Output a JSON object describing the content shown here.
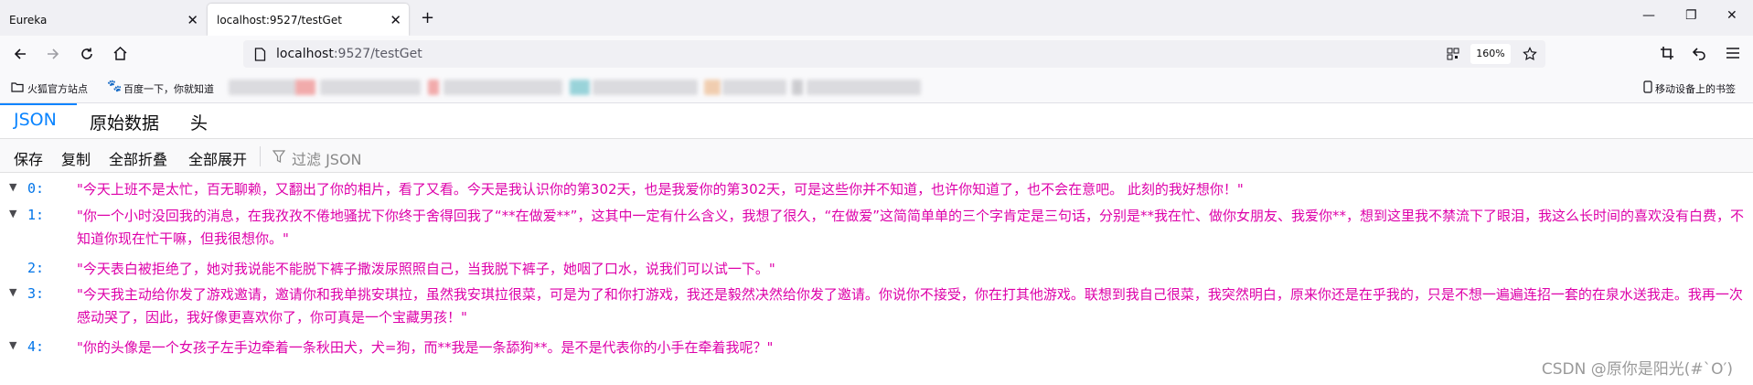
{
  "browser": {
    "tabs": [
      {
        "title": "Eureka"
      },
      {
        "title": "localhost:9527/testGet"
      }
    ],
    "new_tab_symbol": "+",
    "close_symbol": "✕",
    "window_controls": {
      "minimize": "—",
      "restore": "❐",
      "close": "✕"
    },
    "url": {
      "host": "localhost",
      "path": ":9527/testGet"
    },
    "zoom": "160%",
    "bookmarks": [
      {
        "label": "火狐官方站点",
        "icon": "folder-icon"
      },
      {
        "label": "百度一下，你就知道",
        "icon": "baidu-paw-icon"
      }
    ],
    "mobile_bookmarks": "移动设备上的书签"
  },
  "viewer": {
    "tabs": [
      "JSON",
      "原始数据",
      "头"
    ],
    "toolbar": {
      "save": "保存",
      "copy": "复制",
      "collapse_all": "全部折叠",
      "expand_all": "全部展开",
      "filter_placeholder": "过滤 JSON"
    },
    "rows": [
      {
        "key": "0:",
        "value": "\"今天上班不是太忙，百无聊赖，又翻出了你的相片，看了又看。今天是我认识你的第302天，也是我爱你的第302天，可是这些你并不知道，也许你知道了，也不会在意吧。 此刻的我好想你！\""
      },
      {
        "key": "1:",
        "value": "\"你一个小时没回我的消息，在我孜孜不倦地骚扰下你终于舍得回我了“**在做爱**”，这其中一定有什么含义，我想了很久，“在做爱”这简简单单的三个字肯定是三句话，分别是**我在忙、做你女朋友、我爱你**，想到这里我不禁流下了眼泪，我这么长时间的喜欢没有白费，不知道你现在忙干嘛，但我很想你。\""
      },
      {
        "key": "2:",
        "value": "\"今天表白被拒绝了，她对我说能不能脱下裤子撒泼尿照照自己，当我脱下裤子，她咽了口水，说我们可以试一下。\""
      },
      {
        "key": "3:",
        "value": "\"今天我主动给你发了游戏邀请，邀请你和我单挑安琪拉，虽然我安琪拉很菜，可是为了和你打游戏，我还是毅然决然给你发了邀请。你说你不接受，你在打其他游戏。联想到我自己很菜，我突然明白，原来你还是在乎我的，只是不想一遍遍连招一套的在泉水送我走。我再一次感动哭了，因此，我好像更喜欢你了，你可真是一个宝藏男孩！\""
      },
      {
        "key": "4:",
        "value": "\"你的头像是一个女孩子左手边牵着一条秋田犬，犬=狗，而**我是一条舔狗**。是不是代表你的小手在牵着我呢？\""
      }
    ]
  },
  "watermark": "CSDN @原你是阳光(#`O′)"
}
